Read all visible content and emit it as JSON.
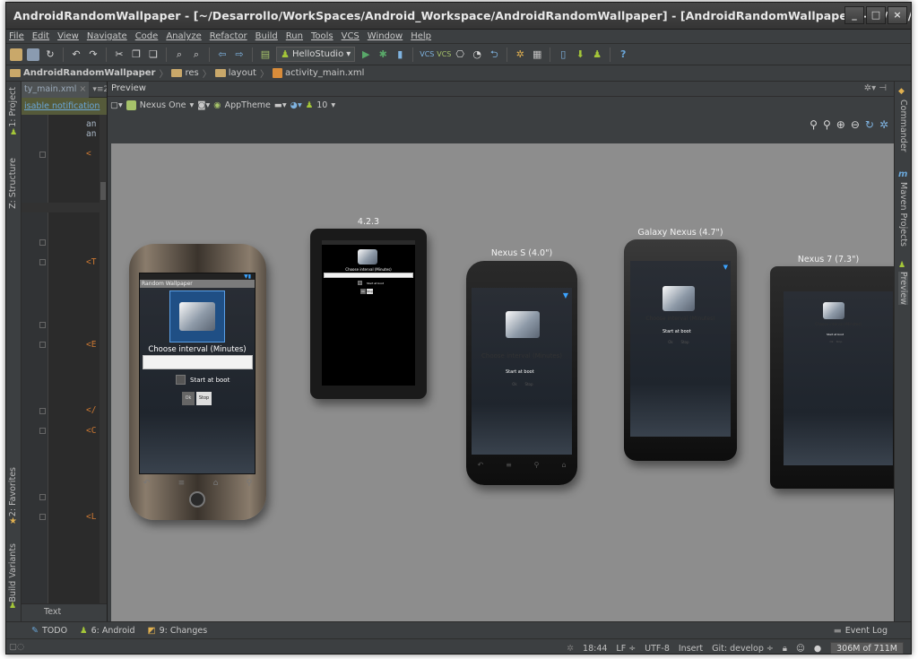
{
  "window": {
    "title": "AndroidRandomWallpaper - [~/Desarrollo/WorkSpaces/Android_Workspace/AndroidRandomWallpaper] - [AndroidRandomWallpaper] - .../res/layout/activity_main.:",
    "minimize": "_",
    "maximize": "□",
    "close": "×"
  },
  "menu": [
    "File",
    "Edit",
    "View",
    "Navigate",
    "Code",
    "Analyze",
    "Refactor",
    "Build",
    "Run",
    "Tools",
    "VCS",
    "Window",
    "Help"
  ],
  "toolbar": {
    "run_config": "HelloStudio"
  },
  "breadcrumb": [
    "AndroidRandomWallpaper",
    "res",
    "layout",
    "activity_main.xml"
  ],
  "left_tabs": {
    "project": "1: Project",
    "structure": "Z: Structure",
    "favorites": "2: Favorites",
    "build_variants": "Build Variants"
  },
  "right_tabs": {
    "commander": "Commander",
    "maven": "Maven Projects",
    "preview": "Preview"
  },
  "editor": {
    "tab_label": "ty_main.xml",
    "tab_count": "2",
    "notification": "isable notification",
    "code": [
      "an",
      "an",
      "<",
      "<T",
      "<E",
      "</",
      "<C",
      "<L"
    ],
    "bottom_tab": "Text"
  },
  "preview": {
    "title": "Preview",
    "device": "Nexus One",
    "theme": "AppTheme",
    "api": "10",
    "devices": {
      "d1": "4.2.3",
      "d2": "Nexus S (4.0\")",
      "d3": "Galaxy Nexus (4.7\")",
      "d4": "Nexus 7 (7.3\")"
    },
    "app": {
      "app_name": "Random Wallpaper",
      "choose": "Choose interval (Minutes)",
      "start_at_boot": "Start at boot",
      "ok": "Ok",
      "stop": "Stop"
    }
  },
  "bottom": {
    "todo": "TODO",
    "android": "6: Android",
    "changes": "9: Changes",
    "event_log": "Event Log"
  },
  "status": {
    "position": "18:44",
    "line_sep": "LF ÷",
    "encoding": "UTF-8",
    "mode": "Insert",
    "git": "Git: develop ÷",
    "memory": "306M of 711M"
  }
}
